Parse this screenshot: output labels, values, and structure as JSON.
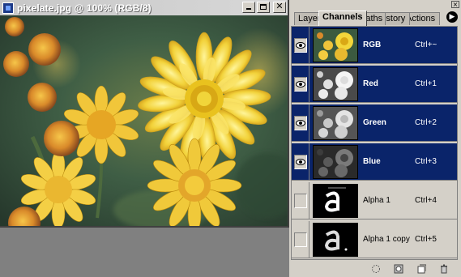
{
  "document": {
    "title": "pixelate.jpg @ 100% (RGB/8)",
    "icons": [
      "photoshop-doc-icon",
      "minimize-icon",
      "maximize-icon",
      "close-icon"
    ],
    "close_glyph": "✕"
  },
  "palette": {
    "tabs": [
      {
        "label": "Layers",
        "active": false
      },
      {
        "label": "Channels",
        "active": true
      },
      {
        "label": "Paths",
        "active": false
      },
      {
        "label": "History",
        "active": false
      },
      {
        "label": "Actions",
        "active": false
      }
    ],
    "channels": [
      {
        "name": "RGB",
        "shortcut": "Ctrl+~",
        "visible": true,
        "selected": true
      },
      {
        "name": "Red",
        "shortcut": "Ctrl+1",
        "visible": true,
        "selected": true
      },
      {
        "name": "Green",
        "shortcut": "Ctrl+2",
        "visible": true,
        "selected": true
      },
      {
        "name": "Blue",
        "shortcut": "Ctrl+3",
        "visible": true,
        "selected": true
      },
      {
        "name": "Alpha 1",
        "shortcut": "Ctrl+4",
        "visible": false,
        "selected": false
      },
      {
        "name": "Alpha 1 copy",
        "shortcut": "Ctrl+5",
        "visible": false,
        "selected": false
      }
    ],
    "footer_icons": [
      "load-selection-icon",
      "save-selection-icon",
      "new-channel-icon",
      "delete-channel-icon"
    ]
  },
  "colors": {
    "selection": "#0a246a",
    "panel": "#d4d0c8",
    "workspace": "#808080"
  }
}
